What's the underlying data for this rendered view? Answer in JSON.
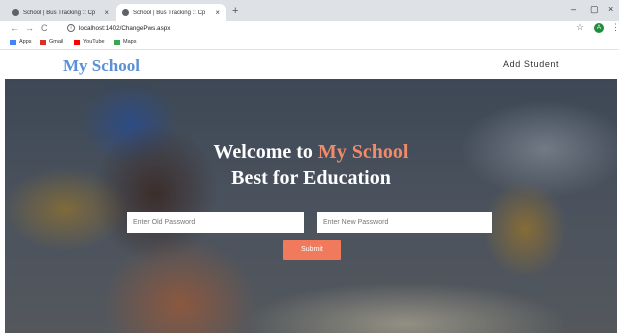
{
  "browser": {
    "tabs": [
      {
        "title": "School | Bus Tracking :: Cp"
      },
      {
        "title": "School | Bus Tracking :: Cp"
      }
    ],
    "new_tab_glyph": "+",
    "close_glyph": "×",
    "window_controls": {
      "minimize": "–",
      "restore": "▢",
      "close": "×"
    },
    "url": "localhost:1402/ChangePws.aspx",
    "profile_initial": "A",
    "bookmarks": [
      {
        "label": "Apps",
        "icon": "apps-grid-icon",
        "color": "#4285f4"
      },
      {
        "label": "Gmail",
        "icon": "gmail-icon",
        "color": "#d93025"
      },
      {
        "label": "YouTube",
        "icon": "youtube-icon",
        "color": "#ff0000"
      },
      {
        "label": "Maps",
        "icon": "maps-icon",
        "color": "#34a853"
      }
    ]
  },
  "site": {
    "logo": "My School",
    "nav": {
      "add_student": "Add Student"
    },
    "hero": {
      "welcome_prefix": "Welcome to ",
      "welcome_accent": "My School",
      "subtitle": "Best for Education"
    },
    "form": {
      "old_password_placeholder": "Enter Old Password",
      "new_password_placeholder": "Enter New Password",
      "submit_label": "Submit"
    }
  },
  "colors": {
    "logo": "#5b8fd6",
    "accent": "#f08a68",
    "submit": "#f27a5c"
  }
}
